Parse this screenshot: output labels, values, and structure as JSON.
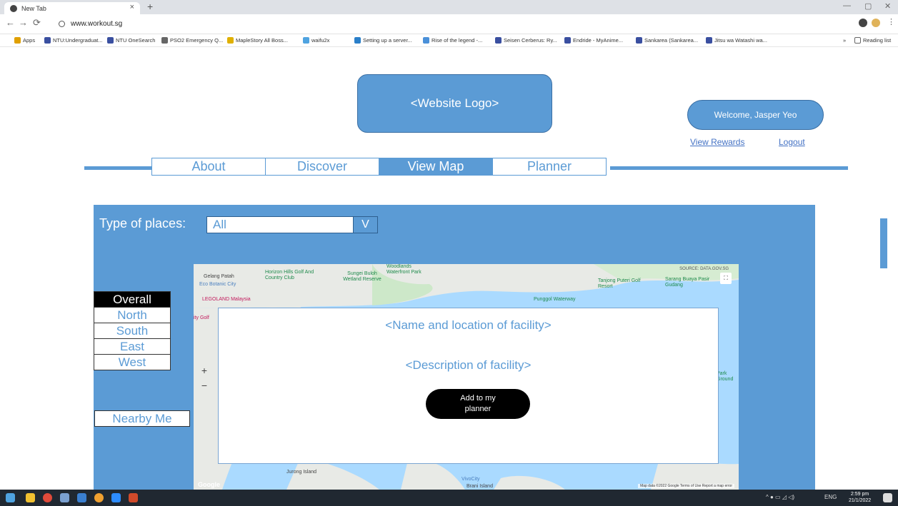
{
  "browser": {
    "tab_title": "New Tab",
    "tab_close": "×",
    "new_tab": "+",
    "url": "www.workout.sg",
    "bookmarks": [
      "Apps",
      "NTU:Undergraduat...",
      "NTU OneSearch",
      "PSO2 Emergency Q...",
      "MapleStory All Boss...",
      "waifu2x",
      "Setting up a server...",
      "Rise of the legend -...",
      "Seisen Cerberus: Ry...",
      "Endride - MyAnime...",
      "Sankarea (Sankarea...",
      "Jitsu wa Watashi wa..."
    ],
    "overflow": "»",
    "reading_list": "Reading list"
  },
  "header": {
    "logo": "<Website Logo>",
    "welcome": "Welcome, Jasper Yeo",
    "view_rewards": "View Rewards",
    "logout": "Logout"
  },
  "nav": {
    "tabs": [
      "About",
      "Discover",
      "View Map",
      "Planner"
    ],
    "active": "View Map"
  },
  "filters": {
    "type_label": "Type of places:",
    "type_value": "All",
    "dropdown_arrow": "V",
    "regions": [
      "Overall",
      "North",
      "South",
      "East",
      "West"
    ],
    "active_region": "Overall",
    "nearby": "Nearby Me"
  },
  "map": {
    "source": "SOURCE: DATA.GOV.SG",
    "labels": {
      "horizon": "Horizon Hills Golf And Country Club",
      "gelang": "Gelang Patah",
      "eco": "Eco Botanic City",
      "legoland": "LEGOLAND Malaysia",
      "sungei": "Sungei Buloh Wetland Reserve",
      "woodlands": "Woodlands Waterfront Park",
      "tanjong": "Tanjong Puteri Golf Resort",
      "sarang": "Sarang Buaya Pasir Gudang",
      "punggol": "Punggol Waterway",
      "jurong": "Jurong Island",
      "vivocity": "VivoCity",
      "brani": "Brani Island",
      "golf": "ity Golf",
      "park": "Park Ground"
    },
    "zoom_in": "+",
    "zoom_out": "−",
    "google": "Google",
    "attribution": "Map data ©2022 Google   Terms of Use   Report a map error"
  },
  "facility": {
    "name": "<Name and location of facility>",
    "description": "<Description of facility>",
    "add_button": "Add to my planner"
  },
  "taskbar": {
    "lang": "ENG",
    "time": "2:59 pm",
    "date": "21/1/2022"
  },
  "colors": {
    "accent": "#5b9bd5",
    "link": "#4472c4",
    "dark": "#000000"
  }
}
